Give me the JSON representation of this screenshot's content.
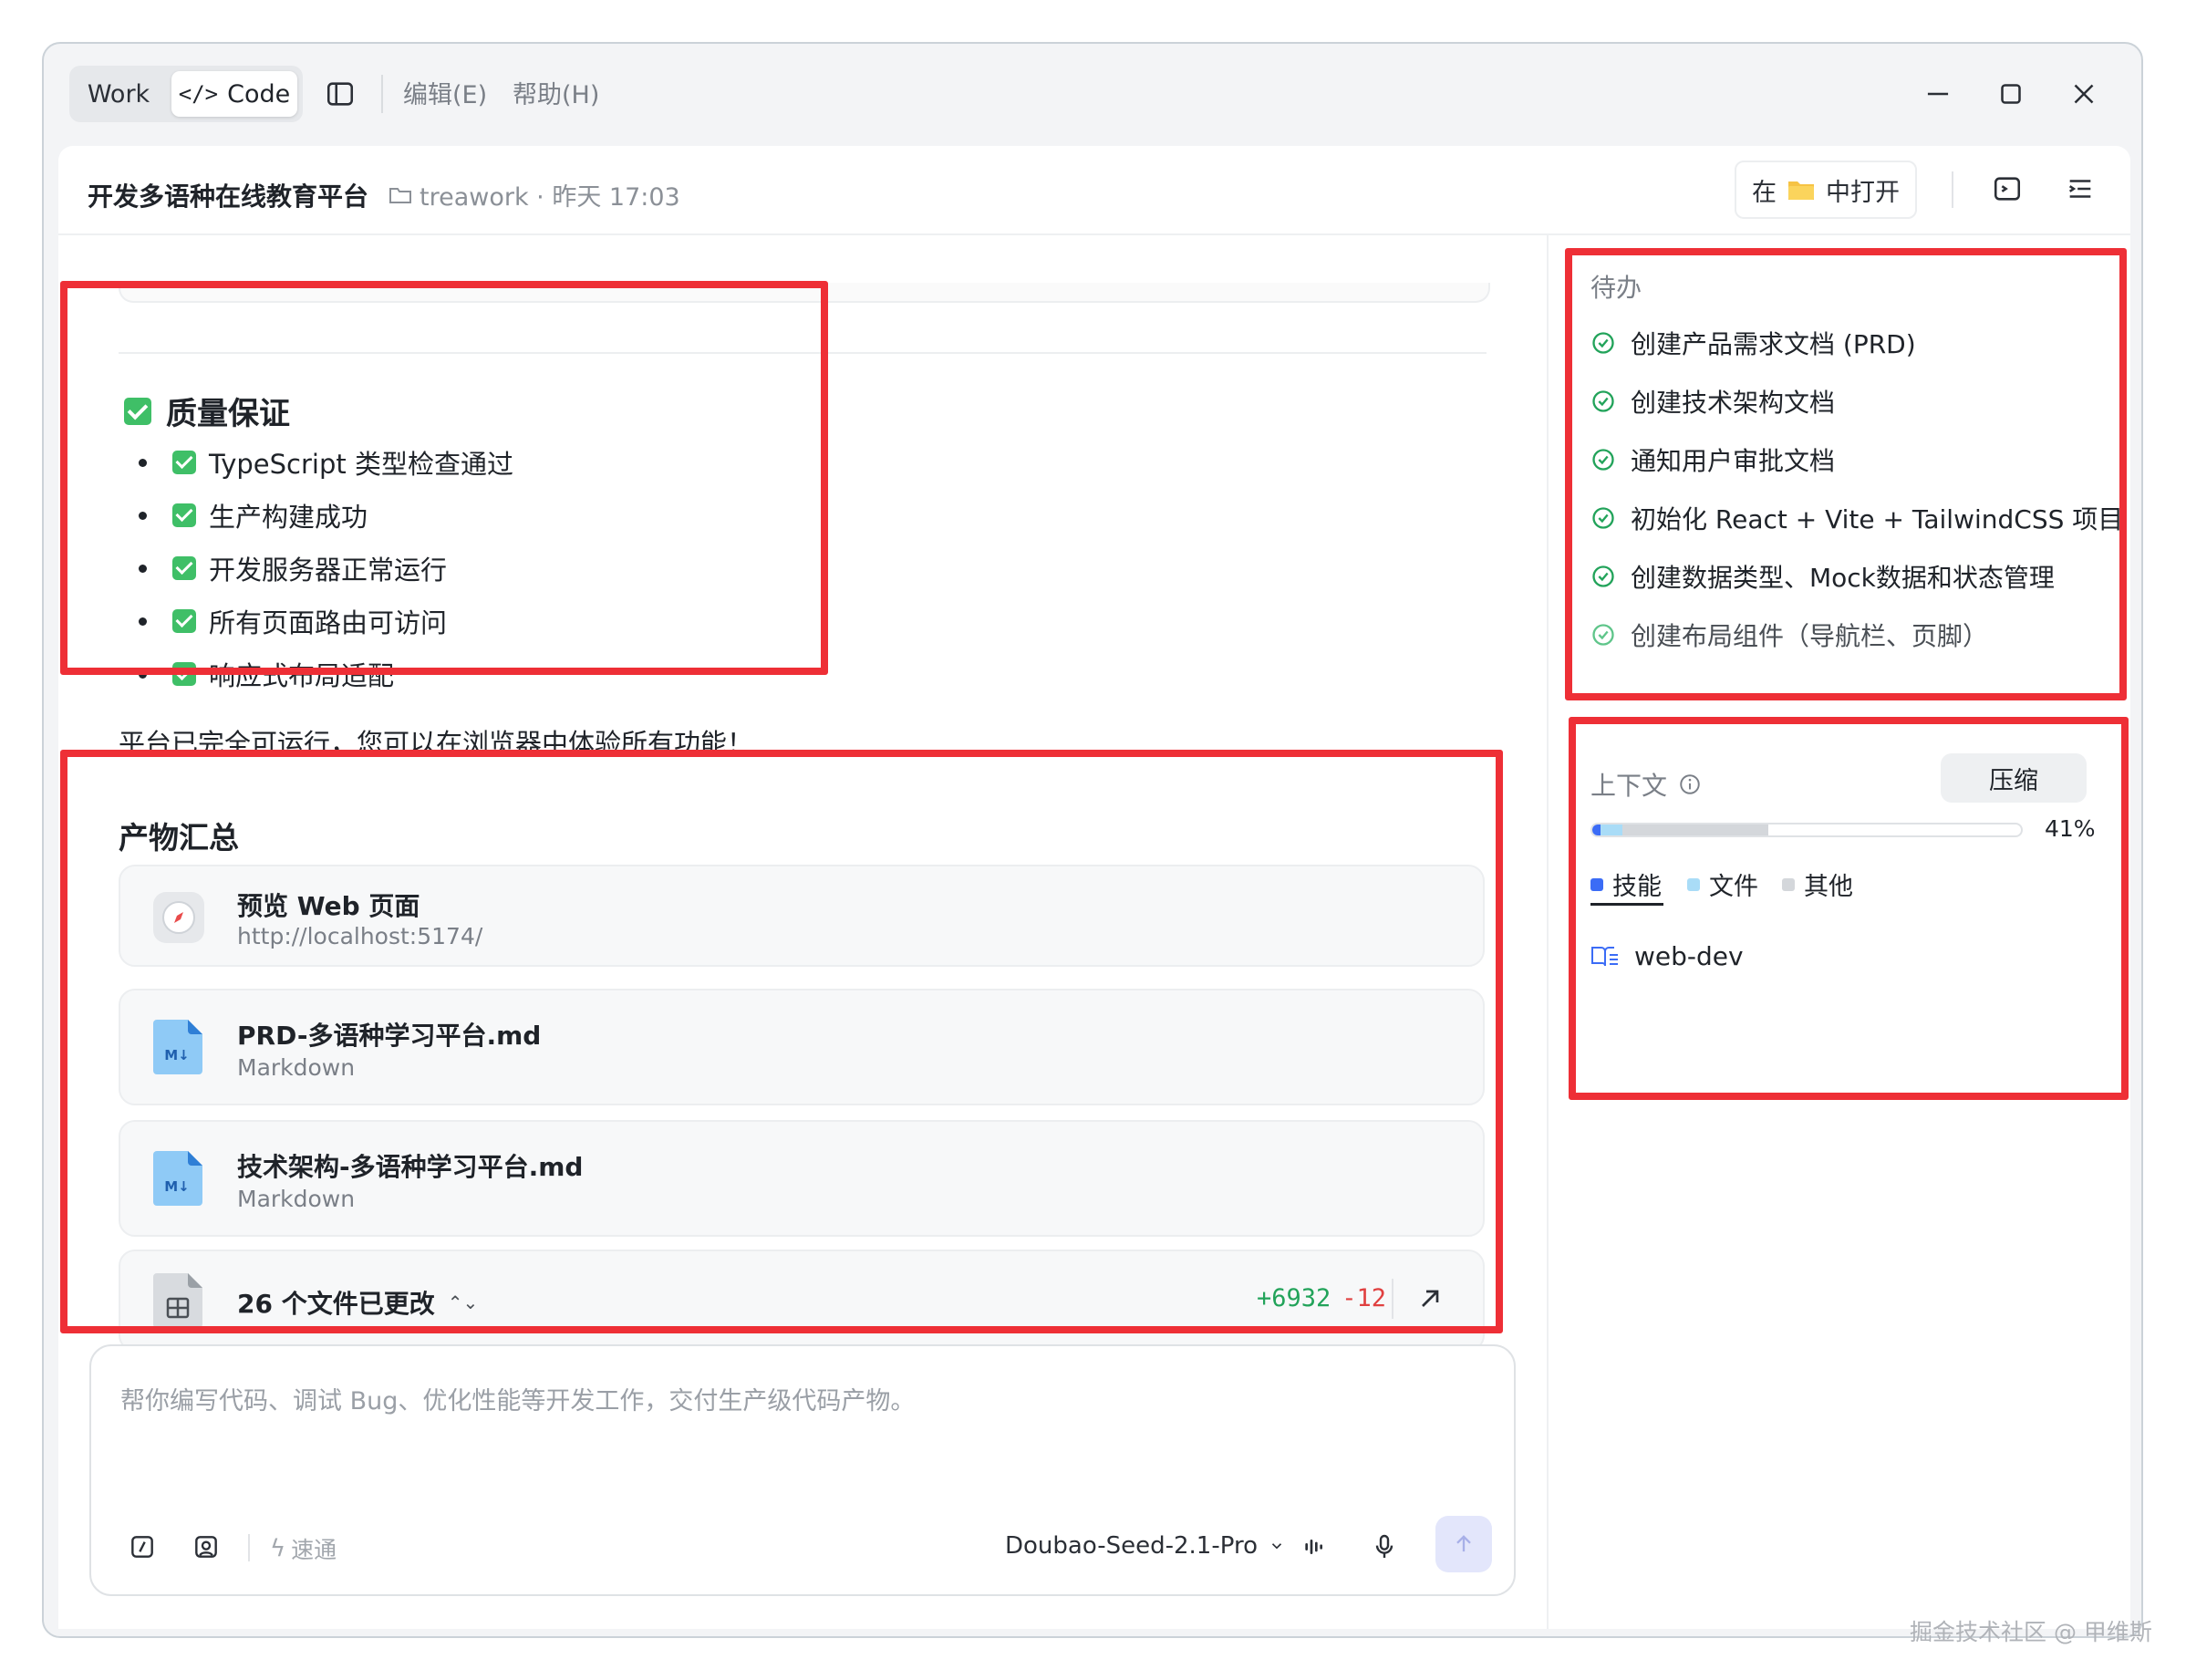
{
  "titlebar": {
    "mode_work": "Work",
    "mode_code": "Code",
    "menu_edit": "编辑(E)",
    "menu_help": "帮助(H)"
  },
  "header": {
    "title": "开发多语种在线教育平台",
    "workspace": "treawork · 昨天 17:03",
    "open_prefix": "在",
    "open_suffix": "中打开"
  },
  "chat": {
    "qa_heading": "质量保证",
    "qa_items": [
      "TypeScript 类型检查通过",
      "生产构建成功",
      "开发服务器正常运行",
      "所有页面路由可访问",
      "响应式布局适配"
    ],
    "done_text": "平台已完全可运行，您可以在浏览器中体验所有功能！",
    "artifacts_heading": "产物汇总",
    "artifacts": [
      {
        "title": "预览 Web 页面",
        "subtitle": "http://localhost:5174/",
        "icon": "compass-icon"
      },
      {
        "title": "PRD-多语种学习平台.md",
        "subtitle": "Markdown",
        "icon": "markdown-file-icon"
      },
      {
        "title": "技术架构-多语种学习平台.md",
        "subtitle": "Markdown",
        "icon": "markdown-file-icon"
      }
    ],
    "changes": {
      "label": "26 个文件已更改",
      "added": "+6932",
      "removed": "-12"
    }
  },
  "input": {
    "placeholder": "帮你编写代码、调试 Bug、优化性能等开发工作，交付生产级代码产物。",
    "speed_label": "速通",
    "model": "Doubao-Seed-2.1-Pro"
  },
  "sidebar": {
    "todo_title": "待办",
    "todos": [
      "创建产品需求文档 (PRD)",
      "创建技术架构文档",
      "通知用户审批文档",
      "初始化 React + Vite + TailwindCSS 项目",
      "创建数据类型、Mock数据和状态管理",
      "创建布局组件（导航栏、页脚）"
    ],
    "context_title": "上下文",
    "compress_label": "压缩",
    "usage_percent": "41%",
    "usage_fill": {
      "skills": 0.02,
      "files": 0.05,
      "other": 0.34
    },
    "legend": [
      {
        "label": "技能",
        "color": "#3b6cf6"
      },
      {
        "label": "文件",
        "color": "#a9dcf7"
      },
      {
        "label": "其他",
        "color": "#d4d7db"
      }
    ],
    "skill_item": "web-dev"
  },
  "watermark": "掘金技术社区 @ 甲维斯",
  "colors": {
    "accent": "#3b6cf6",
    "success": "#22a35a",
    "danger": "#e04040",
    "highlight": "#ee2f36"
  }
}
